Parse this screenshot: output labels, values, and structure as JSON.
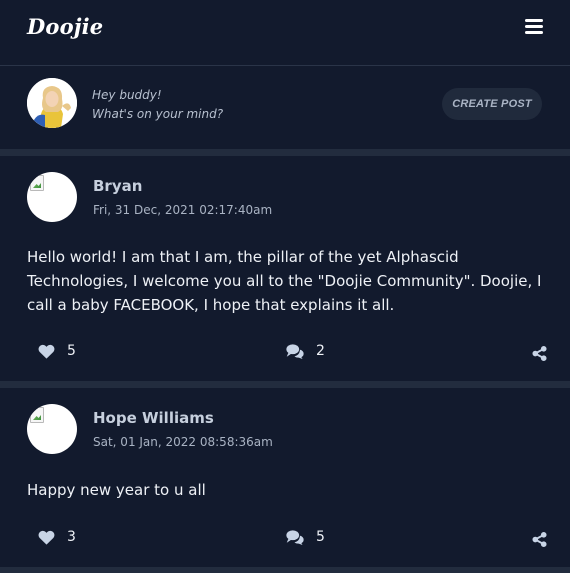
{
  "header": {
    "logo_text": "Doojie",
    "menu_icon": "hamburger-menu-icon"
  },
  "composer": {
    "line1": "Hey buddy!",
    "line2": "What's on your mind?",
    "create_label": "CREATE POST"
  },
  "posts": [
    {
      "author": "Bryan",
      "date": "Fri, 31 Dec, 2021 02:17:40am",
      "text": "Hello world! I am that I am, the pillar of the yet Alphascid Technologies, I welcome you all to the \"Doojie Community\". Doojie, I call a baby FACEBOOK, I hope that explains it all.",
      "likes": "5",
      "comments": "2"
    },
    {
      "author": "Hope Williams",
      "date": "Sat, 01 Jan, 2022 08:58:36am",
      "text": "Happy new year to u all",
      "likes": "3",
      "comments": "5"
    }
  ],
  "colors": {
    "background": "#121a2d",
    "separator": "#222c3e",
    "button_bg": "#202a3c",
    "icon": "#c8d4e6"
  }
}
